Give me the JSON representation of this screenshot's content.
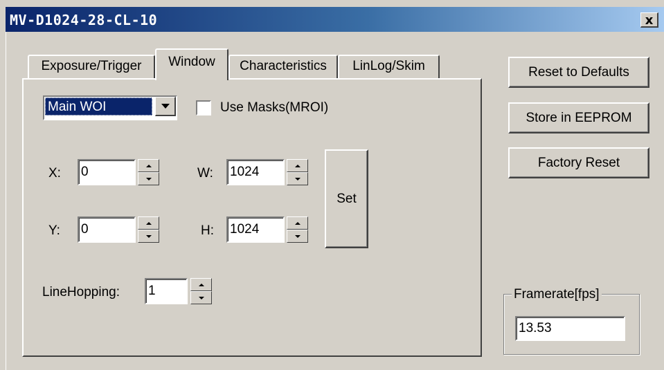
{
  "window": {
    "title": "MV-D1024-28-CL-10",
    "close_label": "x"
  },
  "tabs": [
    {
      "label": "Exposure/Trigger",
      "active": false
    },
    {
      "label": "Window",
      "active": true
    },
    {
      "label": "Characteristics",
      "active": false
    },
    {
      "label": "LinLog/Skim",
      "active": false
    }
  ],
  "window_tab": {
    "woi_select": {
      "value": "Main WOI"
    },
    "use_masks": {
      "label": "Use Masks(MROI)",
      "checked": false
    },
    "x": {
      "label": "X:",
      "value": "0"
    },
    "y": {
      "label": "Y:",
      "value": "0"
    },
    "w": {
      "label": "W:",
      "value": "1024"
    },
    "h": {
      "label": "H:",
      "value": "1024"
    },
    "set_button": "Set",
    "line_hopping": {
      "label": "LineHopping:",
      "value": "1"
    }
  },
  "side_buttons": {
    "reset_defaults": "Reset to Defaults",
    "store_eeprom": "Store in EEPROM",
    "factory_reset": "Factory Reset"
  },
  "framerate": {
    "label": "Framerate[fps]",
    "value": "13.53"
  },
  "icons": {
    "close": "close-icon",
    "dropdown": "chevron-down-icon",
    "spin_up": "spin-up-icon",
    "spin_down": "spin-down-icon"
  }
}
